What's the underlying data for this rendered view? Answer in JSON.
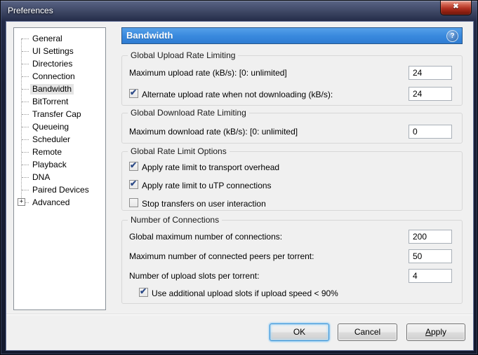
{
  "colors": {
    "header_accent": "#3a8ade",
    "titlebar": "#222a47",
    "close_button": "#b03121",
    "selection_bg": "#e4e4e4",
    "dialog_bg": "#f0f0f0"
  },
  "window": {
    "title": "Preferences"
  },
  "icons": {
    "close": "✖",
    "help": "?",
    "expand": "+"
  },
  "sidebar": {
    "selected": "Bandwidth",
    "items": [
      {
        "label": "General"
      },
      {
        "label": "UI Settings"
      },
      {
        "label": "Directories"
      },
      {
        "label": "Connection"
      },
      {
        "label": "Bandwidth"
      },
      {
        "label": "BitTorrent"
      },
      {
        "label": "Transfer Cap"
      },
      {
        "label": "Queueing"
      },
      {
        "label": "Scheduler"
      },
      {
        "label": "Remote"
      },
      {
        "label": "Playback"
      },
      {
        "label": "DNA"
      },
      {
        "label": "Paired Devices"
      },
      {
        "label": "Advanced",
        "expandable": true
      }
    ]
  },
  "main": {
    "header": {
      "title": "Bandwidth"
    },
    "groups": [
      {
        "title": "Global Upload Rate Limiting",
        "rows": [
          {
            "label": "Maximum upload rate (kB/s): [0: unlimited]",
            "value": "24"
          },
          {
            "label": "Alternate upload rate when not downloading (kB/s):",
            "value": "24",
            "checkbox": true,
            "checked": true
          }
        ]
      },
      {
        "title": "Global Download Rate Limiting",
        "rows": [
          {
            "label": "Maximum download rate (kB/s): [0: unlimited]",
            "value": "0"
          }
        ]
      },
      {
        "title": "Global Rate Limit Options",
        "checkboxes": [
          {
            "label": "Apply rate limit to transport overhead",
            "checked": true
          },
          {
            "label": "Apply rate limit to uTP connections",
            "checked": true
          },
          {
            "label": "Stop transfers on user interaction",
            "checked": false
          }
        ]
      },
      {
        "title": "Number of Connections",
        "rows": [
          {
            "label": "Global maximum number of connections:",
            "value": "200"
          },
          {
            "label": "Maximum number of connected peers per torrent:",
            "value": "50"
          },
          {
            "label": "Number of upload slots per torrent:",
            "value": "4"
          }
        ],
        "checkbox": {
          "label": "Use additional upload slots if upload speed < 90%",
          "checked": true
        }
      }
    ]
  },
  "footer": {
    "ok": "OK",
    "cancel": "Cancel",
    "apply_accesskey": "A",
    "apply_rest": "pply"
  }
}
